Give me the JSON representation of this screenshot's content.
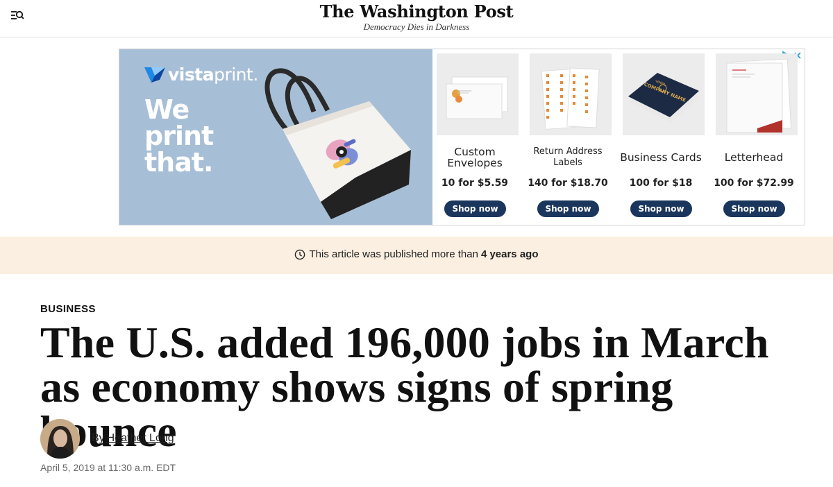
{
  "header": {
    "logo": "The Washington Post",
    "tagline": "Democracy Dies in Darkness",
    "menu_icon": "menu-search-icon"
  },
  "ad": {
    "brand": {
      "prefix": "vista",
      "suffix": "print",
      "dot": "."
    },
    "headline_lines": [
      "We",
      "print",
      "that."
    ],
    "products": [
      {
        "title": "Custom Envelopes",
        "price": "10 for $5.59",
        "cta": "Shop now"
      },
      {
        "title": "Return Address Labels",
        "price": "140 for $18.70",
        "cta": "Shop now"
      },
      {
        "title": "Business Cards",
        "price": "100 for $18",
        "cta": "Shop now"
      },
      {
        "title": "Letterhead",
        "price": "100 for $72.99",
        "cta": "Shop now"
      }
    ],
    "card_text": {
      "top": "·HMPA·",
      "name": "COMPANY NAME"
    },
    "adchoices_icon": "adchoices-icon",
    "close_icon": "close-icon",
    "colors": {
      "bg": "#a7bfd6",
      "button": "#1b365d"
    }
  },
  "banner": {
    "text": "This article was published more than",
    "emphasis": "4 years ago",
    "icon": "clock-icon"
  },
  "article": {
    "kicker": "BUSINESS",
    "headline": "The U.S. added 196,000 jobs in March as economy shows signs of spring bounce",
    "byline_prefix": "By",
    "author": "Heather Long",
    "timestamp": "April 5, 2019 at 11:30 a.m. EDT"
  }
}
